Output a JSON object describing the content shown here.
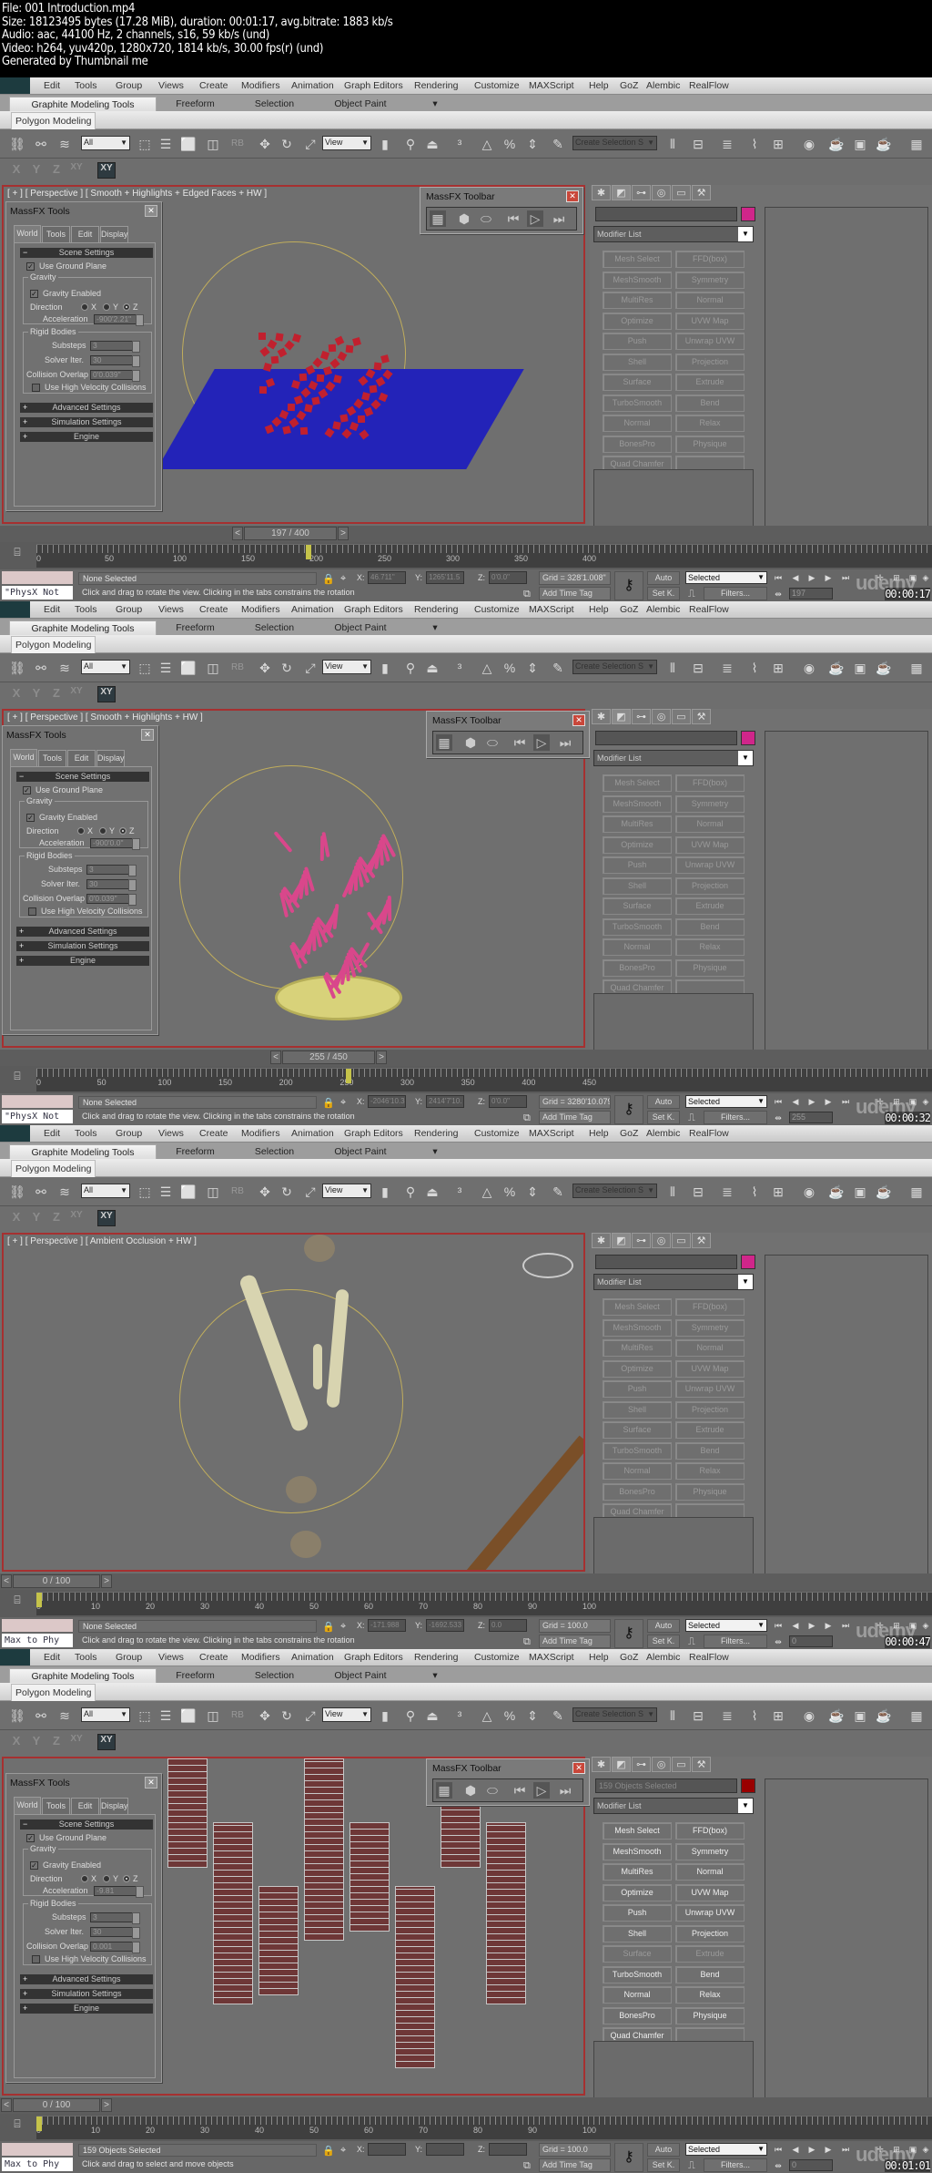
{
  "header": {
    "lines": [
      "File: 001 Introduction.mp4",
      "Size: 18123495 bytes (17.28 MiB), duration: 00:01:17, avg.bitrate: 1883 kb/s",
      "Audio: aac, 44100 Hz, 2 channels, s16, 59 kb/s (und)",
      "Video: h264, yuv420p, 1280x720, 1814 kb/s, 30.00 fps(r) (und)",
      "Generated by Thumbnail me"
    ]
  },
  "common": {
    "menu": [
      "Edit",
      "Tools",
      "Group",
      "Views",
      "Create",
      "Modifiers",
      "Animation",
      "Graph Editors",
      "Rendering",
      "Customize",
      "MAXScript",
      "Help",
      "GoZ",
      "Alembic",
      "RealFlow"
    ],
    "ribbon_tabs": [
      "Graphite Modeling Tools",
      "Freeform",
      "Selection",
      "Object Paint"
    ],
    "ribbon_sub": "Polygon Modeling",
    "toolbar": {
      "filter": "All",
      "ref_coord": "View",
      "named_sel": "Create Selection S"
    },
    "axis_buttons": [
      "X",
      "Y",
      "Z",
      "XY",
      "XY"
    ],
    "massfx_tools": {
      "title": "MassFX Tools",
      "tabs": [
        "World",
        "Tools",
        "Edit",
        "Display"
      ],
      "scene_settings": "Scene Settings",
      "use_ground_plane": "Use Ground Plane",
      "gravity_group": "Gravity",
      "gravity_enabled": "Gravity Enabled",
      "direction": "Direction",
      "dir_x": "X",
      "dir_y": "Y",
      "dir_z": "Z",
      "acceleration": "Acceleration",
      "rigid_bodies": "Rigid Bodies",
      "substeps": "Substeps",
      "solver_iter": "Solver Iter.",
      "collision_overlap": "Collision Overlap",
      "high_velocity": "Use High Velocity Collisions",
      "advanced": "Advanced Settings",
      "simulation": "Simulation Settings",
      "engine": "Engine"
    },
    "massfx_toolbar_title": "MassFX Toolbar",
    "modifier_list": "Modifier List",
    "modifiers": [
      "Mesh Select",
      "FFD(box)",
      "MeshSmooth",
      "Symmetry",
      "MultiRes",
      "Normal",
      "Optimize",
      "UVW Map",
      "Push",
      "Unwrap UVW",
      "Shell",
      "Projection",
      "Surface",
      "Extrude",
      "TurboSmooth",
      "Bend",
      "Normal",
      "Relax",
      "BonesPro",
      "Physique",
      "Quad Chamfer",
      ""
    ],
    "time_tag": "Add Time Tag",
    "auto_key": "Auto",
    "set_key": "Set K.",
    "key_filter": "Selected",
    "filters": "Filters...",
    "watermark": "udemy",
    "coord_labels": {
      "x": "X:",
      "y": "Y:",
      "z": "Z:"
    }
  },
  "frames": [
    {
      "viewport_label": "[ + ] [ Perspective ] [ Smooth + Highlights + Edged Faces + HW ]",
      "massfx": {
        "acceleration": "-900'2.21\"",
        "substeps": "3",
        "solver_iter": "30",
        "collision_overlap": "0'0.039\""
      },
      "object_name": "",
      "object_color": "#d0268a",
      "time_slider": "197 / 400",
      "track_ticks": [
        "0",
        "50",
        "100",
        "150",
        "200",
        "250",
        "300",
        "350",
        "400"
      ],
      "track_key_frac": 0.4925,
      "selection": "None Selected",
      "prompt": "Click and drag to rotate the view.  Clicking in the tabs constrains the rotation",
      "x": "46.711\"",
      "y": "1265'11.5",
      "z": "0'0.0\"",
      "grid": "Grid = 328'1.008\"",
      "current_frame": "197",
      "maxscript": "\"PhysX Not",
      "timestamp": "00:00:17",
      "scene": "cubes"
    },
    {
      "viewport_label": "[ + ] [ Perspective ] [ Smooth + Highlights + HW ]",
      "massfx": {
        "acceleration": "-900'0.0\"",
        "substeps": "3",
        "solver_iter": "30",
        "collision_overlap": "0'0.039\""
      },
      "object_name": "",
      "object_color": "#d0268a",
      "time_slider": "255 / 450",
      "track_ticks": [
        "0",
        "50",
        "100",
        "150",
        "200",
        "250",
        "300",
        "350",
        "400",
        "450"
      ],
      "track_key_frac": 0.567,
      "selection": "None Selected",
      "prompt": "Click and drag to rotate the view.  Clicking in the tabs constrains the rotation",
      "x": "-2046'10.3",
      "y": "2414'7'10.",
      "z": "0'0.0\"",
      "grid": "Grid = 3280'10.079",
      "current_frame": "255",
      "maxscript": "\"PhysX Not",
      "timestamp": "00:00:32",
      "scene": "sticks"
    },
    {
      "viewport_label": "[ + ] [ Perspective ] [ Ambient Occlusion + HW ]",
      "massfx": null,
      "object_name": "",
      "object_color": "#d0268a",
      "time_slider": "0 / 100",
      "track_ticks": [
        "0",
        "10",
        "20",
        "30",
        "40",
        "50",
        "60",
        "70",
        "80",
        "90",
        "100"
      ],
      "track_key_frac": 0.0,
      "selection": "None Selected",
      "prompt": "Click and drag to rotate the view.  Clicking in the tabs constrains the rotation",
      "x": "-171.988",
      "y": "-1692.533",
      "z": "0.0",
      "grid": "Grid = 100.0",
      "current_frame": "0",
      "maxscript": "Max to Phy",
      "timestamp": "00:00:47",
      "scene": "bones"
    },
    {
      "viewport_label": "",
      "massfx": {
        "acceleration": "-9.81",
        "substeps": "3",
        "solver_iter": "30",
        "collision_overlap": "0.001"
      },
      "object_name": "159 Objects Selected",
      "object_color": "#990000",
      "time_slider": "0 / 100",
      "track_ticks": [
        "0",
        "10",
        "20",
        "30",
        "40",
        "50",
        "60",
        "70",
        "80",
        "90",
        "100"
      ],
      "track_key_frac": 0.0,
      "selection": "159 Objects Selected",
      "prompt": "Click and drag to select and move objects",
      "x": "",
      "y": "",
      "z": "",
      "grid": "Grid = 100.0",
      "current_frame": "0",
      "maxscript": "Max to Phy",
      "timestamp": "00:01:01",
      "scene": "wireframe"
    }
  ]
}
